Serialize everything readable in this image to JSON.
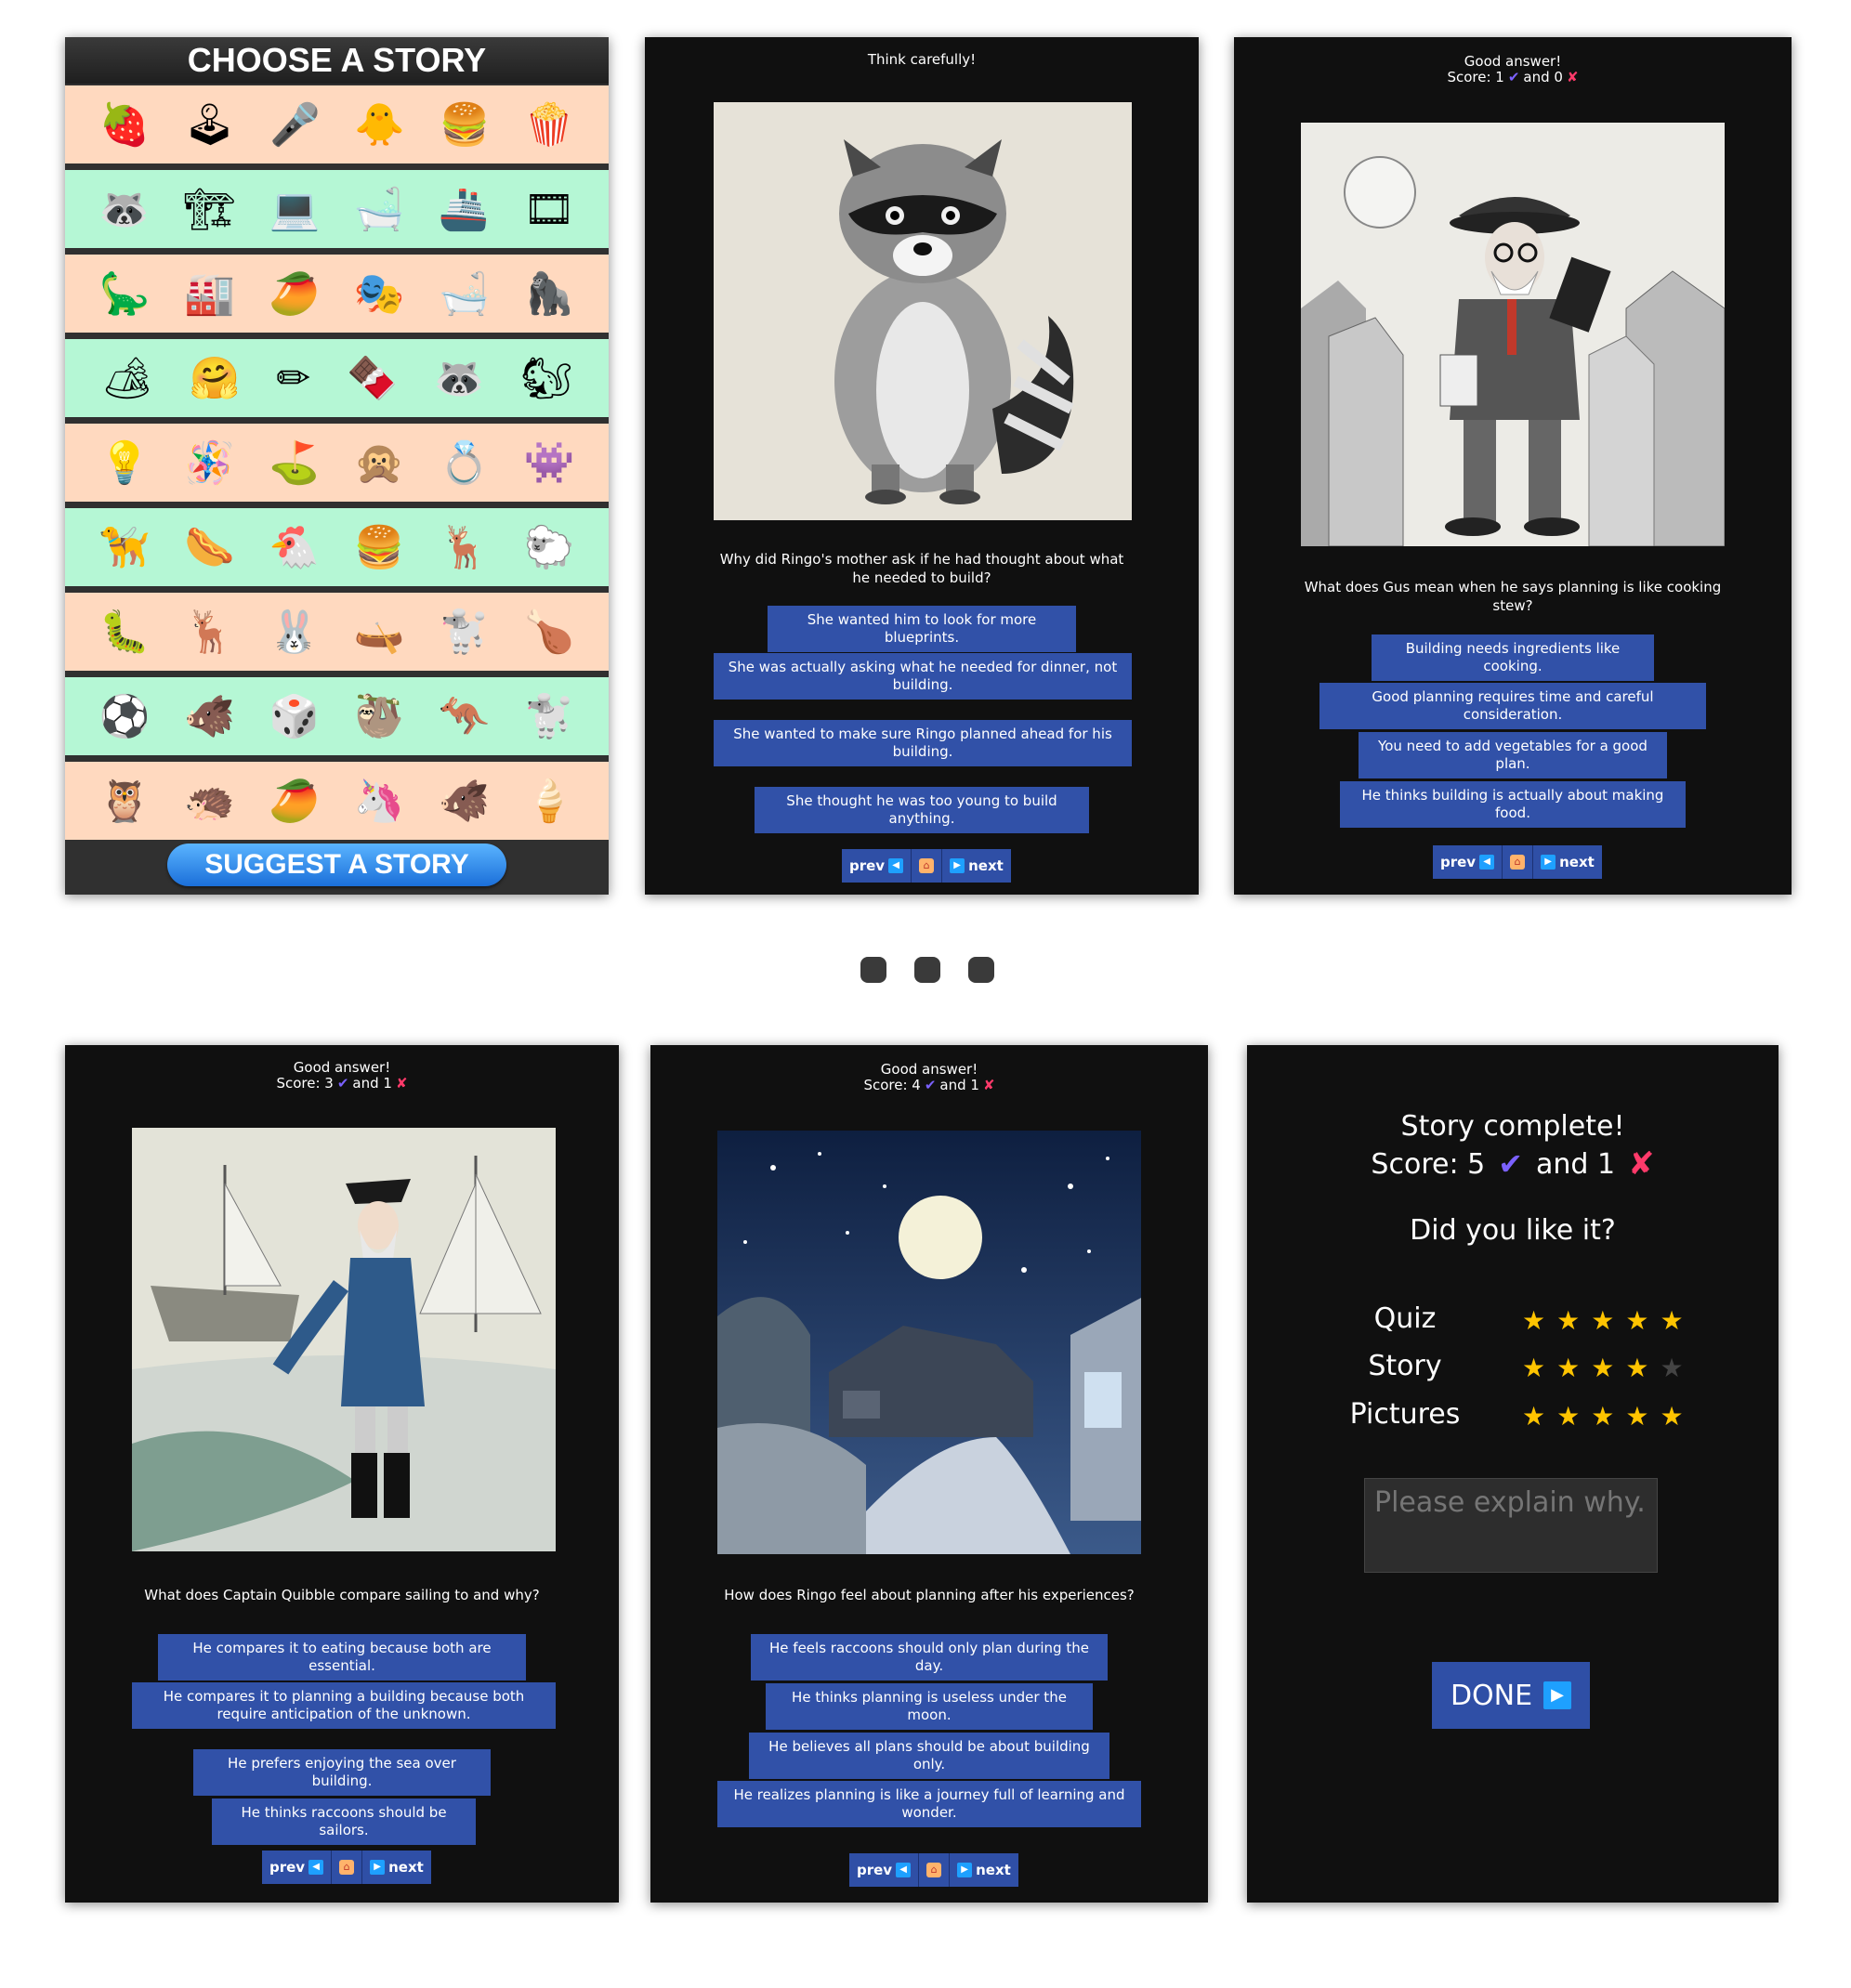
{
  "chooser": {
    "title": "CHOOSE A STORY",
    "rows": [
      [
        "🍓",
        "🕹",
        "🎤",
        "🐥",
        "🍔",
        "🍿"
      ],
      [
        "🦝",
        "🏗",
        "💻",
        "🛁",
        "🚢",
        "🎞"
      ],
      [
        "🦕",
        "🏭",
        "🥭",
        "🎭",
        "🛁",
        "🦍"
      ],
      [
        "🏕",
        "🤗",
        "✏",
        "🍫",
        "🦝",
        "🐿"
      ],
      [
        "💡",
        "🪅",
        "⛳",
        "🙊",
        "💍",
        "👾"
      ],
      [
        "🦮",
        "🌭",
        "🐔",
        "🍔",
        "🦌",
        "🐑"
      ],
      [
        "🐛",
        "🦌",
        "🐰",
        "🛶",
        "🐩",
        "🍗"
      ],
      [
        "⚽",
        "🐗",
        "🎲",
        "🦥",
        "🦘",
        "🐩"
      ],
      [
        "🦉",
        "🦔",
        "🥭",
        "🦄",
        "🐗",
        "🍦"
      ]
    ],
    "suggest_label": "SUGGEST A STORY"
  },
  "nav": {
    "prev": "prev",
    "next": "next"
  },
  "screen2": {
    "message": "Think carefully!",
    "question": "Why did Ringo's mother ask if he had thought about what he needed to build?",
    "answers": [
      "She wanted him to look for more blueprints.",
      "She was actually asking what he needed for dinner, not building.",
      "She wanted to make sure Ringo planned ahead for his building.",
      "She thought he was too young to build anything."
    ]
  },
  "screen3": {
    "message": "Good answer!",
    "score_label": "Score: 1",
    "score_and": "and 0",
    "question": "What does Gus mean when he says planning is like cooking stew?",
    "answers": [
      "Building needs ingredients like cooking.",
      "Good planning requires time and careful consideration.",
      "You need to add vegetables for a good plan.",
      "He thinks building is actually about making food."
    ]
  },
  "screen4": {
    "message": "Good answer!",
    "score_label": "Score: 3",
    "score_and": "and 1",
    "question": "What does Captain Quibble compare sailing to and why?",
    "answers": [
      "He compares it to eating because both are essential.",
      "He compares it to planning a building because both require anticipation of the unknown.",
      "He prefers enjoying the sea over building.",
      "He thinks raccoons should be sailors."
    ]
  },
  "screen5": {
    "message": "Good answer!",
    "score_label": "Score: 4",
    "score_and": "and 1",
    "question": "How does Ringo feel about planning after his experiences?",
    "answers": [
      "He feels raccoons should only plan during the day.",
      "He thinks planning is useless under the moon.",
      "He believes all plans should be about building only.",
      "He realizes planning is like a journey full of learning and wonder."
    ]
  },
  "final": {
    "title": "Story complete!",
    "score_label": "Score: 5",
    "score_and": "and 1",
    "question": "Did you like it?",
    "ratings": [
      {
        "label": "Quiz",
        "stars": 5
      },
      {
        "label": "Story",
        "stars": 4
      },
      {
        "label": "Pictures",
        "stars": 5
      }
    ],
    "explain_placeholder": "Please explain why.",
    "done_label": "DONE"
  },
  "icons": {
    "check": "check-icon",
    "cross": "cross-icon",
    "home": "home-icon",
    "prev_arrow": "left-arrow-icon",
    "next_arrow": "right-arrow-icon"
  }
}
